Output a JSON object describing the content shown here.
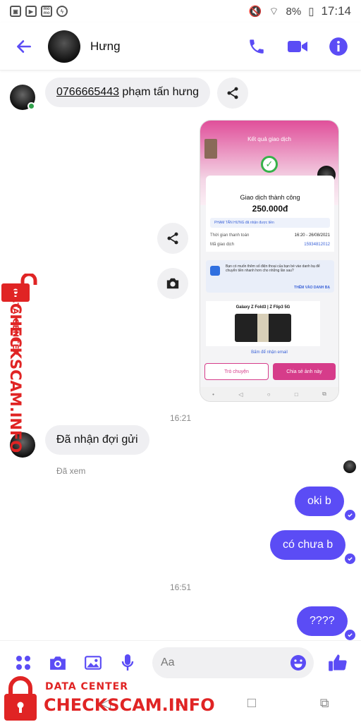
{
  "status_bar": {
    "icons": [
      "gallery-icon",
      "youtube-icon",
      "momo-icon",
      "messenger-icon"
    ],
    "momo_label": "mo mo",
    "battery": "8%",
    "time": "17:14"
  },
  "header": {
    "contact_name": "Hưng",
    "actions": [
      "phone-icon",
      "video-icon",
      "info-icon"
    ]
  },
  "messages": {
    "first": {
      "phone": "0766665443",
      "rest": " phạm tấn hưng"
    },
    "time1": "16:21",
    "received": "Đã nhận đợi gửi",
    "seen": "Đã xem",
    "sent1": "oki b",
    "sent2": "có chưa b",
    "time2": "16:51",
    "sent3": "????"
  },
  "screenshot": {
    "title": "Kết quả giao dịch",
    "status": "Giao dịch thành công",
    "amount": "250.000đ",
    "info": "PHẠM TẤN HƯNG đã nhận được tiền",
    "time_label": "Thời gian thanh toán",
    "time_value": "16:20 - 26/08/2021",
    "code_label": "Mã giao dịch",
    "code_value": "15934812012",
    "note": "Bạn có muốn thêm số điện thoại của bạn bè vào danh bạ để chuyển tiền nhanh hơn cho những lần sau?",
    "note_action": "THÊM VÀO DANH BẠ",
    "ad_title": "Galaxy Z Fold3 | Z Flip3 5G",
    "email_label": "Bấm để nhận email",
    "btn_chat": "Trò chuyện",
    "btn_share": "Chia sẻ ảnh này"
  },
  "composer": {
    "placeholder": "Aa"
  },
  "watermark": {
    "small": "DATA CENTER",
    "big": "CHECKSCAM.INFO"
  },
  "colors": {
    "accent": "#5b4cf5",
    "bubble_in": "#efeff2",
    "watermark": "#e02424"
  }
}
